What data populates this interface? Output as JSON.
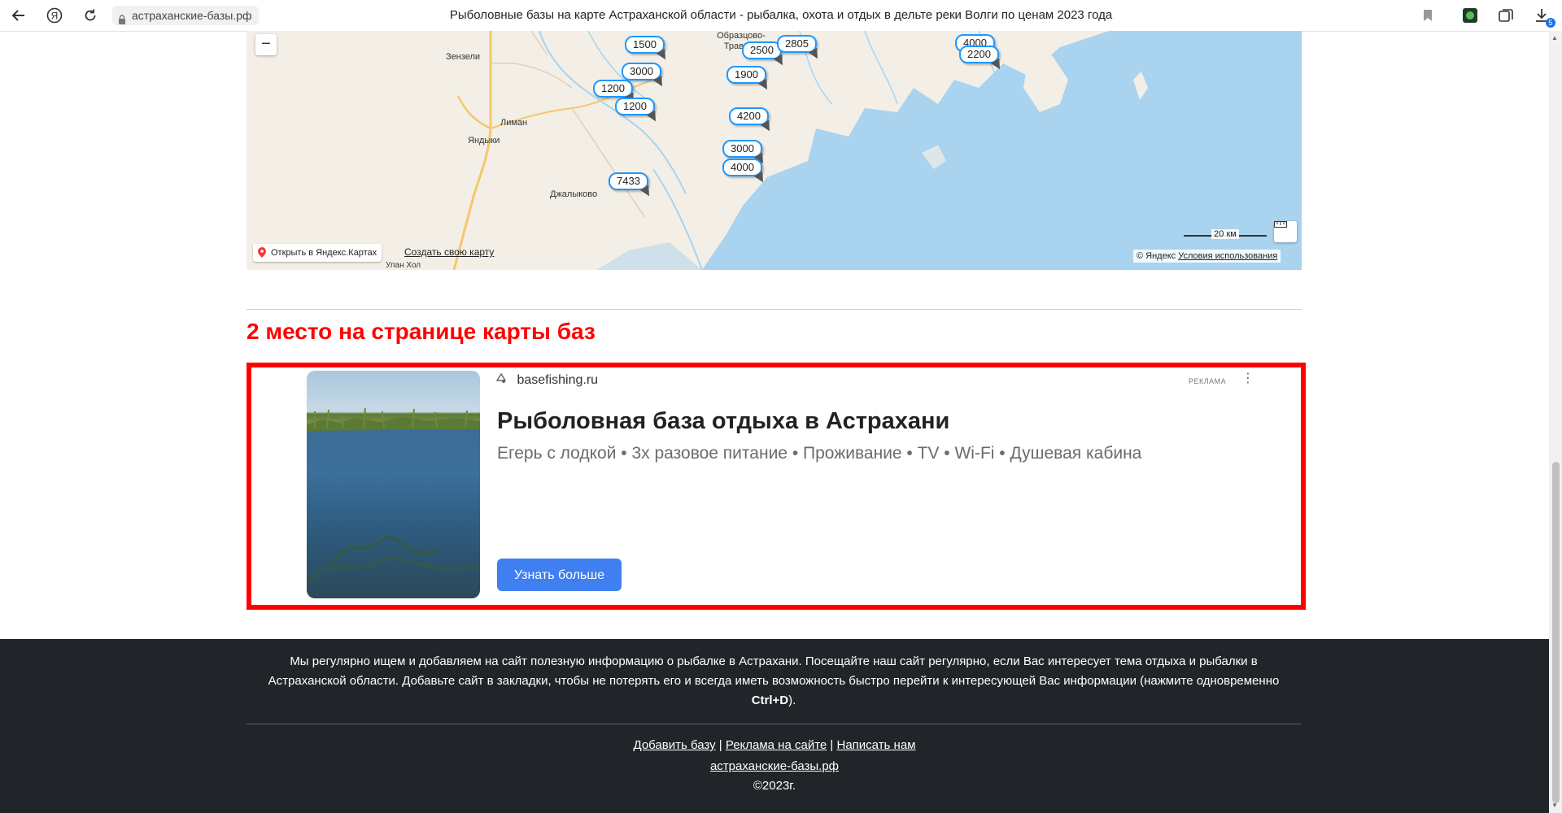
{
  "browser": {
    "address": "астраханские-базы.рф",
    "tab_title": "Рыболовные базы на карте Астраханской области - рыбалка, охота и отдых в дельте реки Волги по ценам 2023 года",
    "download_badge": "5"
  },
  "map": {
    "zoom_out": "−",
    "places": [
      {
        "name": "Зензели"
      },
      {
        "name": "Лиман"
      },
      {
        "name": "Яндыки"
      },
      {
        "name": "Джалыково"
      },
      {
        "name": "Улан Хол"
      },
      {
        "name": "Образцово-Травино"
      }
    ],
    "prices": [
      "1500",
      "3000",
      "1200",
      "1200",
      "7433",
      "2500",
      "2805",
      "1900",
      "4200",
      "3000",
      "4000",
      "4000",
      "2200"
    ],
    "open_yandex": "Открыть в Яндекс.Картах",
    "create_map": "Создать свою карту",
    "scale": "20 км",
    "copyright_prefix": "© Яндекс",
    "terms": "Условия использования"
  },
  "section": {
    "title": "2 место на странице карты баз"
  },
  "ad": {
    "domain": "basefishing.ru",
    "label": "РЕКЛАМА",
    "menu": "⋮",
    "title": "Рыболовная база отдыха в Астрахани",
    "description": "Егерь с лодкой • 3х разовое питание • Проживание • TV • Wi-Fi • Душевая кабина",
    "button": "Узнать больше"
  },
  "footer": {
    "text_main": "Мы регулярно ищем и добавляем на сайт полезную информацию о рыбалке в Астрахани. Посещайте наш сайт регулярно, если Вас интересует тема отдыха и рыбалки в Астраханской области. Добавьте сайт в закладки, чтобы не потерять его и всегда иметь возможность быстро перейти к интересующей Вас информации (нажмите одновременно ",
    "shortcut": "Ctrl+D",
    "text_end": ").",
    "links": [
      "Добавить базу",
      "Реклама на сайте",
      "Написать нам"
    ],
    "separator": "|",
    "site": "астраханские-базы.рф",
    "copyright": "©2023г."
  },
  "colors": {
    "accent_red": "#ff0000",
    "ad_button": "#3f7ff0",
    "footer_bg": "#212529",
    "map_water": "#a9d3ef",
    "map_land": "#f3efe6",
    "pin_border": "#1e98ff"
  }
}
